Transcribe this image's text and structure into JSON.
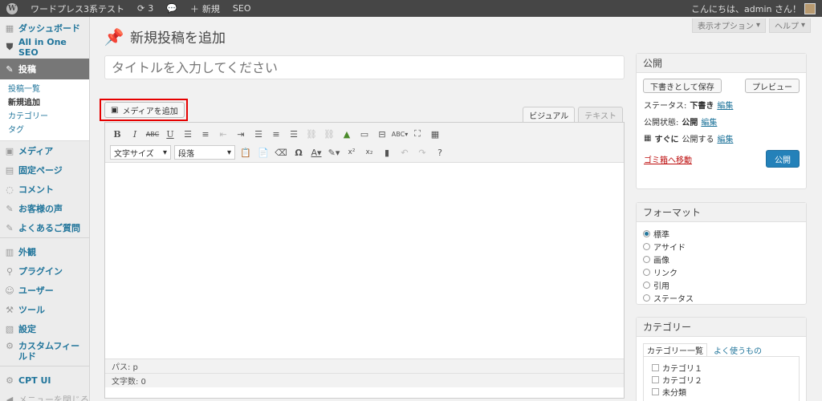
{
  "adminbar": {
    "site_name": "ワードプレス3系テスト",
    "updates_count": "3",
    "new_label": "新規",
    "seo_label": "SEO",
    "greeting": "こんにちは、admin さん！"
  },
  "sidebar": {
    "items": [
      {
        "label": "ダッシュボード",
        "icon": "dashboard-icon"
      },
      {
        "label": "All in One SEO",
        "icon": "shield-icon"
      },
      {
        "label": "投稿",
        "icon": "pin-icon"
      },
      {
        "label": "メディア",
        "icon": "media-icon"
      },
      {
        "label": "固定ページ",
        "icon": "page-icon"
      },
      {
        "label": "コメント",
        "icon": "comment-icon"
      },
      {
        "label": "お客様の声",
        "icon": "pin-icon"
      },
      {
        "label": "よくあるご質問",
        "icon": "pin-icon"
      },
      {
        "label": "外観",
        "icon": "appearance-icon"
      },
      {
        "label": "プラグイン",
        "icon": "plugin-icon"
      },
      {
        "label": "ユーザー",
        "icon": "users-icon"
      },
      {
        "label": "ツール",
        "icon": "tools-icon"
      },
      {
        "label": "設定",
        "icon": "settings-icon"
      },
      {
        "label": "カスタムフィールド",
        "icon": "gear-icon"
      },
      {
        "label": "CPT UI",
        "icon": "gear-icon"
      },
      {
        "label": "メニューを閉じる",
        "icon": "collapse-icon"
      }
    ],
    "submenu": [
      "投稿一覧",
      "新規追加",
      "カテゴリー",
      "タグ"
    ]
  },
  "screen_options": {
    "display_options": "表示オプション",
    "help": "ヘルプ"
  },
  "page": {
    "title": "新規投稿を追加",
    "title_placeholder": "タイトルを入力してください"
  },
  "editor": {
    "add_media": "メディアを追加",
    "tab_visual": "ビジュアル",
    "tab_text": "テキスト",
    "font_size_select": "文字サイズ",
    "format_select": "段落",
    "path": "パス: p",
    "word_count": "文字数: 0"
  },
  "publish_box": {
    "title": "公開",
    "save_draft": "下書きとして保存",
    "preview": "プレビュー",
    "status_label": "ステータス:",
    "status_value": "下書き",
    "visibility_label": "公開状態:",
    "visibility_value": "公開",
    "schedule_label": "すぐに",
    "schedule_suffix": "公開する",
    "edit": "編集",
    "trash": "ゴミ箱へ移動",
    "publish": "公開"
  },
  "format_box": {
    "title": "フォーマット",
    "options": [
      "標準",
      "アサイド",
      "画像",
      "リンク",
      "引用",
      "ステータス"
    ],
    "selected": 0
  },
  "category_box": {
    "title": "カテゴリー",
    "tab_all": "カテゴリー一覧",
    "tab_popular": "よく使うもの",
    "items": [
      "カテゴリ１",
      "カテゴリ２",
      "未分類"
    ]
  },
  "colors": {
    "link": "#21759b",
    "admin_bar": "#464646",
    "primary_button": "#2481b9",
    "highlight": "#e60000"
  }
}
